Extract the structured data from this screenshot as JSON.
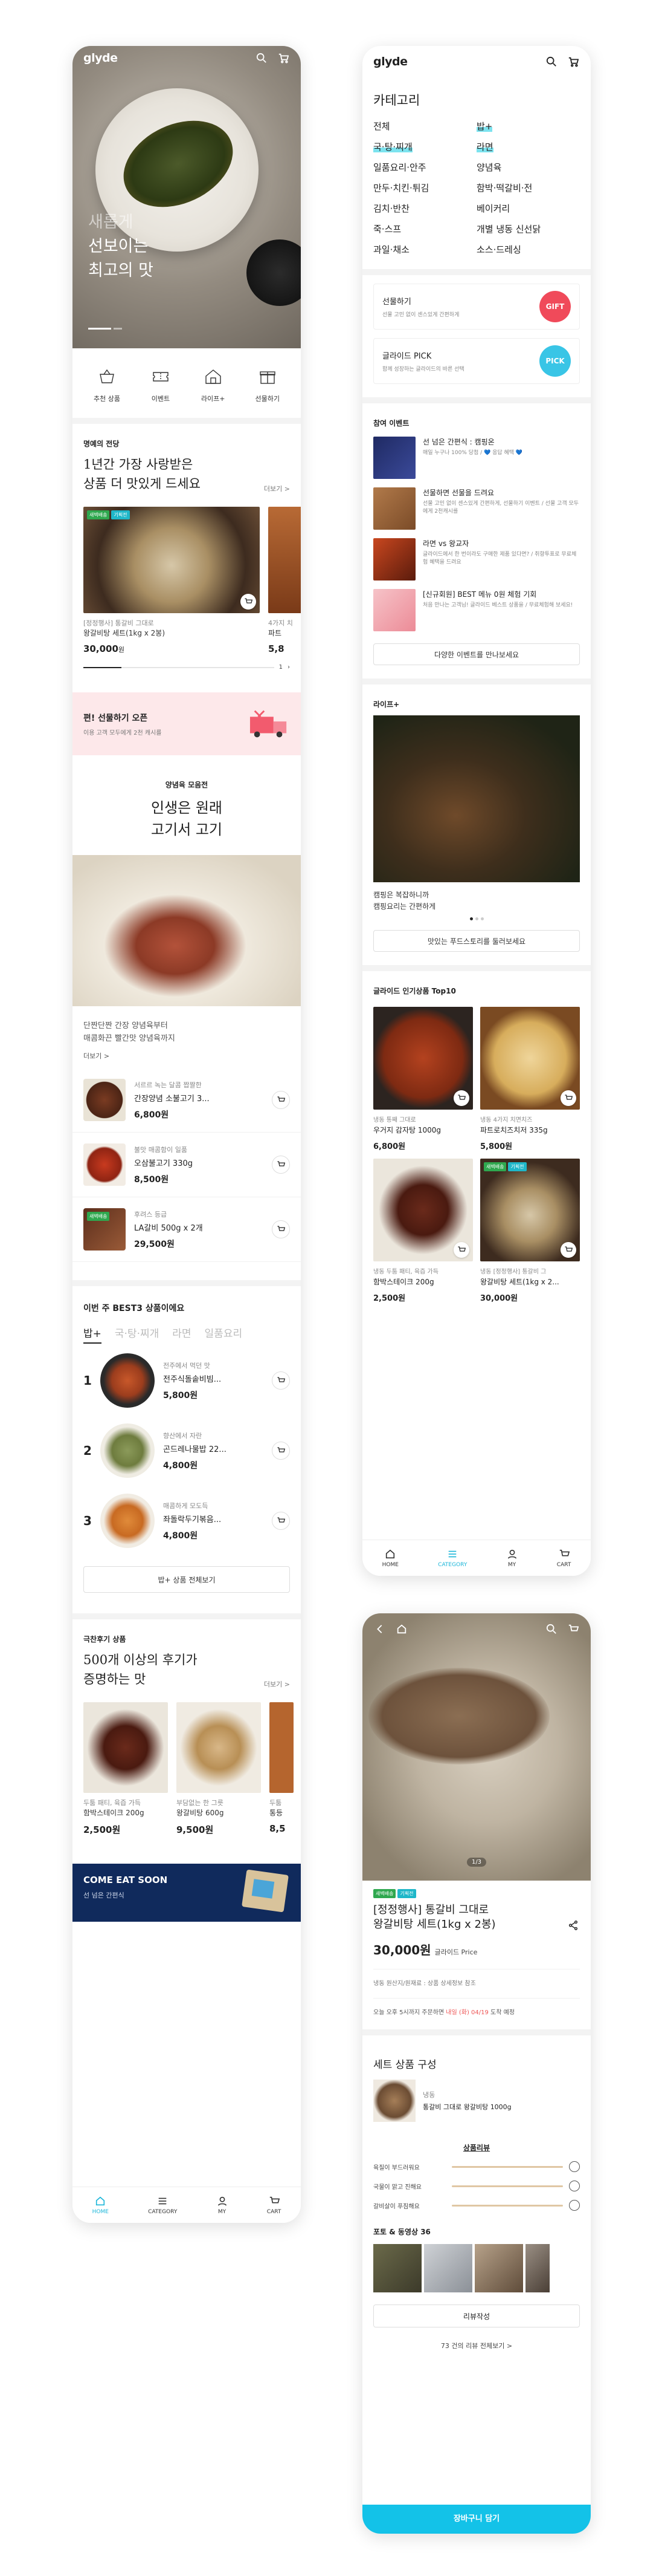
{
  "colors": {
    "accent": "#13c2e8",
    "promo_bg": "#fde8ea",
    "dark_banner": "#102a5c",
    "badge_green": "#2fa84f",
    "badge_teal": "#1fb7c9"
  },
  "brand": {
    "logo": "glyde"
  },
  "home": {
    "hero_lines": [
      "새롭게",
      "선보이는",
      "최고의 맛"
    ],
    "quick_nav": [
      {
        "label": "추천 상품",
        "icon": "basket-icon"
      },
      {
        "label": "이벤트",
        "icon": "ticket-icon"
      },
      {
        "label": "라이프+",
        "icon": "house-icon"
      },
      {
        "label": "선물하기",
        "icon": "gift-icon"
      }
    ],
    "section1": {
      "kicker": "명예의 전당",
      "title_line1": "1년간 가장 사랑받은",
      "title_line2": "상품 더 맛있게 드세요",
      "more": "더보기 >",
      "product": {
        "badges": [
          "새벽배송",
          "기획전"
        ],
        "brand": "[정정행사] 통갈비 그대로",
        "name": "왕갈비탕 세트(1kg x 2봉)",
        "price": "30,000",
        "won": "원"
      },
      "peek_name": "4가지 치",
      "peek_name2": "파트",
      "peek_price": "5,8",
      "pager": "1"
    },
    "gift_banner": {
      "title": "편! 선물하기 오픈",
      "sub": "이용 고객 모두에게 2천 캐시를"
    },
    "section2": {
      "kicker": "양념육 모음전",
      "title_line1": "인생은 원래",
      "title_line2": "고기서 고기",
      "desc_line1": "단짠단짠 간장 양념육부터",
      "desc_line2": "매콤화끈 빨간맛 양념육까지",
      "more": "더보기 >",
      "items": [
        {
          "sub": "서르르 녹는 달콤 짭짤한",
          "name": "간장양념 소불고기 3...",
          "price": "6,800원"
        },
        {
          "sub": "불맛 매콤함이 일품",
          "name": "오삼불고기 330g",
          "price": "8,500원"
        },
        {
          "sub": "후려스 등급",
          "name": "LA갈비 500g x 2개",
          "price": "29,500원",
          "badge": "새벽배송"
        }
      ]
    },
    "best3": {
      "title": "이번 주 BEST3 상품이에요",
      "tabs": [
        "밥+",
        "국·탕·찌개",
        "라면",
        "일품요리"
      ],
      "items": [
        {
          "rank": "1",
          "sub": "전주에서 먹던 맛",
          "name": "전주식돌솥비빔...",
          "price": "5,800원"
        },
        {
          "rank": "2",
          "sub": "향산에서 자란",
          "name": "곤드레나물밥 22...",
          "price": "4,800원"
        },
        {
          "rank": "3",
          "sub": "매콤하게 모도득",
          "name": "좌돌락두기볶음...",
          "price": "4,800원"
        }
      ],
      "button": "밥+ 상품 전체보기"
    },
    "reviews": {
      "kicker": "극찬후기 상품",
      "title_line1": "500개 이상의 후기가",
      "title_line2": "증명하는 맛",
      "more": "더보기 >",
      "items": [
        {
          "sub": "두툼 패티, 육즙 가득",
          "name": "함박스테이크 200g",
          "price": "2,500원"
        },
        {
          "sub": "부담없는 한 그릇",
          "name": "왕갈비탕 600g",
          "price": "9,500원"
        },
        {
          "sub": "두툼",
          "name": "통등",
          "price": "8,5"
        }
      ]
    },
    "come_banner": {
      "title": "COME EAT SOON",
      "sub": "선 넘은 간편식"
    }
  },
  "bottom_nav": [
    {
      "label": "HOME",
      "icon": "home-icon"
    },
    {
      "label": "CATEGORY",
      "icon": "menu-icon"
    },
    {
      "label": "MY",
      "icon": "user-icon"
    },
    {
      "label": "CART",
      "icon": "cart-icon"
    }
  ],
  "category": {
    "title": "카테고리",
    "items": [
      "전체",
      "밥+",
      "국·탕·찌개",
      "라면",
      "일품요리·안주",
      "양념육",
      "만두·치킨·튀김",
      "함박·떡갈비·전",
      "김치·반찬",
      "베이커리",
      "죽·스프",
      "개별 냉동 신선닭",
      "과일·채소",
      "소스·드레싱"
    ],
    "promos": [
      {
        "title": "선물하기",
        "sub": "선물 고민 없이 센스있게 간편하게",
        "mark": "GIFT"
      },
      {
        "title": "글라이드 PICK",
        "sub": "함께 성장하는 글라이드의 바른 선택",
        "mark": "PICK"
      }
    ],
    "events_kicker": "참여 이벤트",
    "events": [
      {
        "title": "선 넘은 간편식 : 캠핑온",
        "desc": "매일 누구나 100% 당첨 / 💙 응답 혜택 💙"
      },
      {
        "title": "선물하면 선물을 드려요",
        "desc": "선물 고민 없이 센스있게 간편하게, 선물하기 이벤트 / 선물 고객 모두에게 2천캐시를"
      },
      {
        "title": "라면 vs 왕교자",
        "desc": "글라이드에서 한 번이라도 구매한 제품 있다면? / 취향투표로 무료체험 혜택을 드려요"
      },
      {
        "title": "[신규회원] BEST 메뉴 0원 체험 기회",
        "desc": "처음 만나는 고객님! 글라이드 베스트 상품을 / 무료체험해 보세요!"
      }
    ],
    "events_button": "다양한 이벤트를 만나보세요",
    "life_kicker": "라이프+",
    "life_caption_line1": "캠핑은 복잡하니까",
    "life_caption_line2": "캠핑요리는 간편하게",
    "life_button": "맛있는 푸드스토리를 둘러보세요",
    "top10_kicker": "글라이드 인기상품 Top10",
    "top10": [
      {
        "sub": "냉동  통째 그대로",
        "name": "우거지 감자탕 1000g",
        "price": "6,800원"
      },
      {
        "sub": "냉동  4가지 치면치즈",
        "name": "파트로치즈치저 335g",
        "price": "5,800원"
      },
      {
        "sub": "냉동  두툼 패티, 육즙 가득",
        "name": "함박스테이크 200g",
        "price": "2,500원"
      },
      {
        "sub": "냉동  [정정행사] 통갈비 그",
        "name": "왕갈비탕 세트(1kg x 2...",
        "price": "30,000원",
        "badges": [
          "새벽배송",
          "기획전"
        ]
      }
    ]
  },
  "product": {
    "counter": "1/3",
    "badges": [
      "새벽배송",
      "기획전"
    ],
    "name_line1": "[정정행사] 통갈비 그대로",
    "name_line2": "왕갈비탕 세트(1kg x 2봉)",
    "price": "30,000원",
    "price_note": "글라이드 Price",
    "info": "냉동   원산지/원재료 : 상품 상세정보 참조",
    "ship_prefix": "오늘 오후 5시까지 주문하면 ",
    "ship_date": "내일 (화) 04/19",
    "ship_suffix": " 도착 예정",
    "set_title": "세트 상품 구성",
    "set_item_sub": "냉동",
    "set_item_name": "통갈비 그대로 왕갈비탕 1000g",
    "review_title": "상품리뷰",
    "ratings": [
      "육질이 부드러워요",
      "국물이 맑고 진해요",
      "갈비살이 푸짐해요"
    ],
    "photo_title": "포토 & 동영상 36",
    "review_button": "리뷰작성",
    "all_reviews": "73 건의 리뷰 전체보기 >",
    "buy_button": "장바구니 담기"
  }
}
